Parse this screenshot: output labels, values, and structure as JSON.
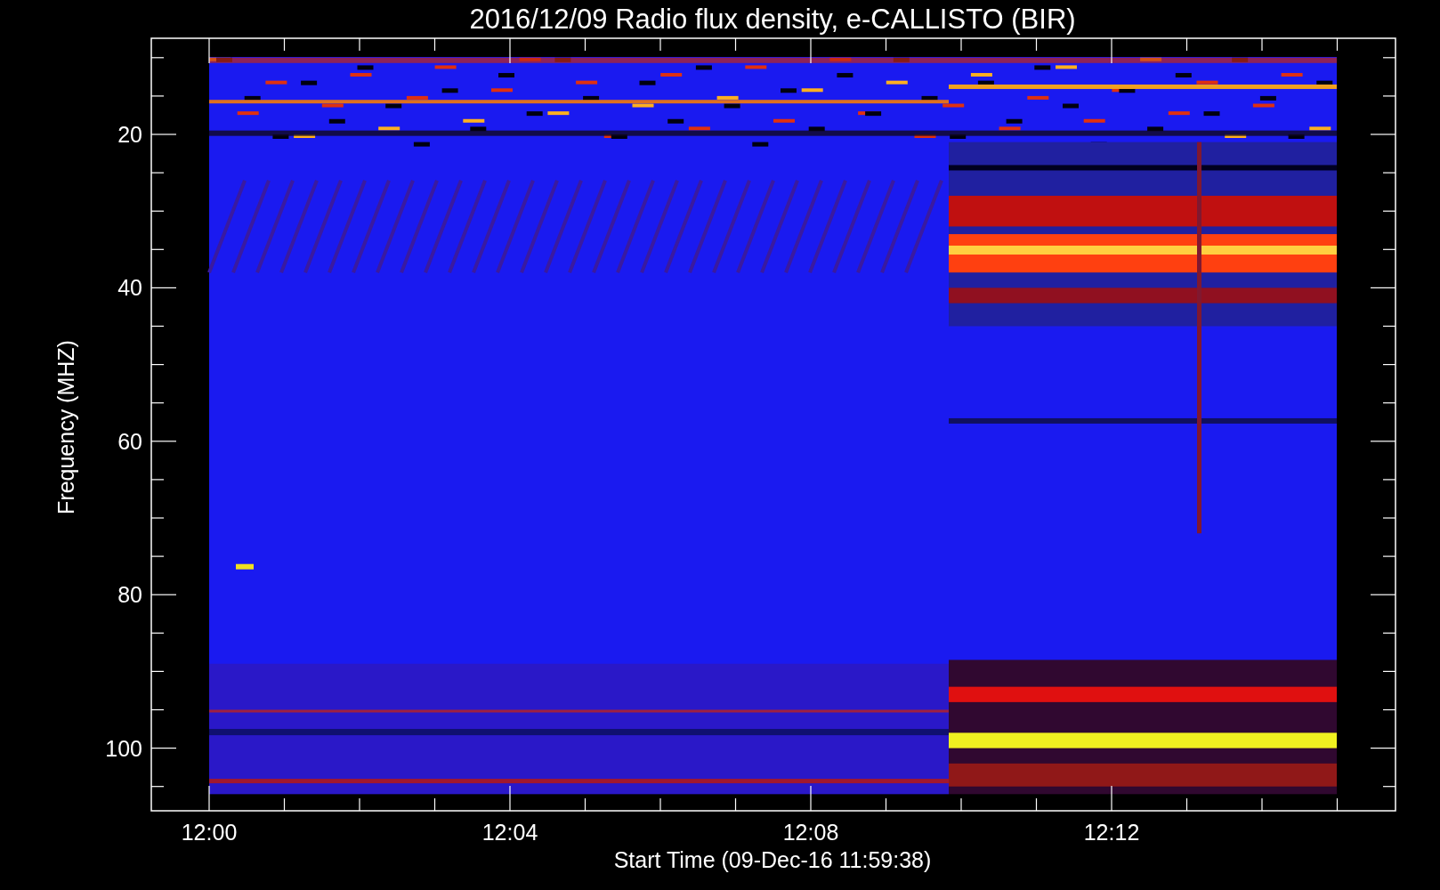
{
  "title": "2016/12/09  Radio flux density, e-CALLISTO (BIR)",
  "ylabel": "Frequency (MHZ)",
  "xlabel": "Start Time (09-Dec-16 11:59:38)",
  "yticks": [
    {
      "label": "20"
    },
    {
      "label": "40"
    },
    {
      "label": "60"
    },
    {
      "label": "80"
    },
    {
      "label": "100"
    }
  ],
  "xticks": [
    {
      "label": "12:00"
    },
    {
      "label": "12:04"
    },
    {
      "label": "12:08"
    },
    {
      "label": "12:12"
    }
  ]
}
